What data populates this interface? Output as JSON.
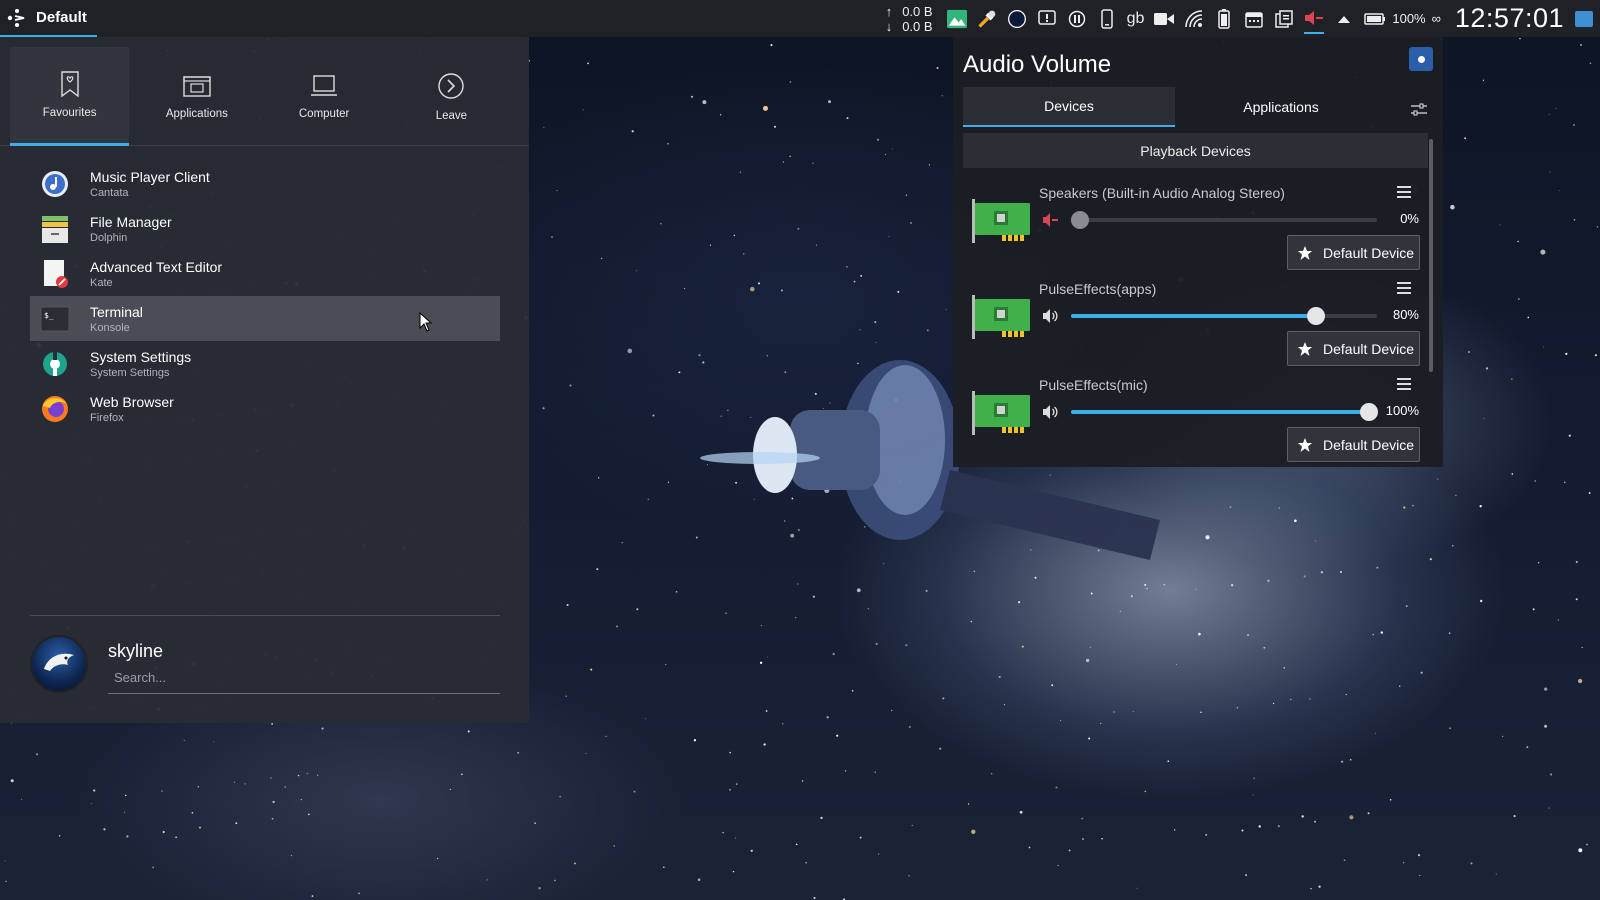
{
  "panel": {
    "launcher_label": "Default",
    "net_up": "0.0 B",
    "net_down": "0.0 B",
    "keyboard_layout": "gb",
    "battery_pct": "100%",
    "clock": "12:57:01"
  },
  "menu": {
    "tabs": [
      {
        "label": "Favourites",
        "icon": "favourites-icon"
      },
      {
        "label": "Applications",
        "icon": "applications-icon"
      },
      {
        "label": "Computer",
        "icon": "computer-icon"
      },
      {
        "label": "Leave",
        "icon": "leave-icon"
      }
    ],
    "items": [
      {
        "title": "Music Player Client",
        "subtitle": "Cantata",
        "icon": "cantata-icon"
      },
      {
        "title": "File Manager",
        "subtitle": "Dolphin",
        "icon": "dolphin-icon"
      },
      {
        "title": "Advanced Text Editor",
        "subtitle": "Kate",
        "icon": "kate-icon"
      },
      {
        "title": "Terminal",
        "subtitle": "Konsole",
        "icon": "konsole-icon"
      },
      {
        "title": "System Settings",
        "subtitle": "System Settings",
        "icon": "settings-icon"
      },
      {
        "title": "Web Browser",
        "subtitle": "Firefox",
        "icon": "firefox-icon"
      }
    ],
    "user": "skyline",
    "search_placeholder": "Search..."
  },
  "audio": {
    "title": "Audio Volume",
    "tabs": [
      "Devices",
      "Applications"
    ],
    "section": "Playback Devices",
    "default_label": "Default Device",
    "devices": [
      {
        "name": "Speakers (Built-in Audio Analog Stereo)",
        "volume": 0,
        "volume_label": "0%",
        "muted": true
      },
      {
        "name": "PulseEffects(apps)",
        "volume": 80,
        "volume_label": "80%",
        "muted": false
      },
      {
        "name": "PulseEffects(mic)",
        "volume": 100,
        "volume_label": "100%",
        "muted": false
      }
    ]
  },
  "colors": {
    "accent": "#3daee9",
    "muted": "#da4453"
  }
}
